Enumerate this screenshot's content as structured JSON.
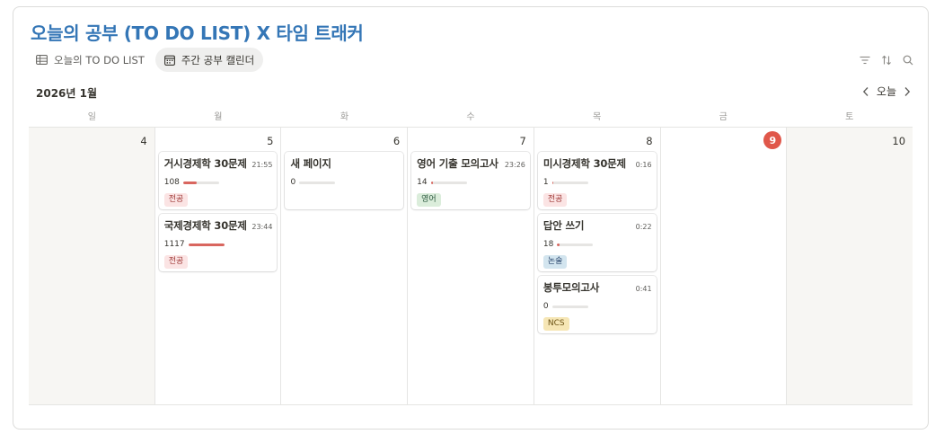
{
  "database": {
    "title": "오늘의 공부 (TO DO LIST) X 타임 트래커"
  },
  "views": [
    {
      "label": "오늘의 TO DO LIST",
      "icon": "table-icon",
      "active": false
    },
    {
      "label": "주간 공부 캘린더",
      "icon": "calendar-icon",
      "active": true
    }
  ],
  "toolbar": {
    "icons": [
      "filter-icon",
      "sort-icon",
      "search-icon"
    ]
  },
  "calendar": {
    "month": "2026년 1월",
    "today_label": "오늘",
    "weekdays": [
      "일",
      "월",
      "화",
      "수",
      "목",
      "금",
      "토"
    ],
    "days": [
      {
        "num": "4",
        "weekend": true,
        "today": false,
        "cards": []
      },
      {
        "num": "5",
        "weekend": false,
        "today": false,
        "cards": [
          {
            "title": "거시경제학 30문제",
            "time": "21:55",
            "count": "108",
            "progress": 0.38,
            "tag": "전공",
            "tag_bg": "#fbe4e4",
            "tag_fg": "#9f3a38"
          },
          {
            "title": "국제경제학 30문제",
            "time": "23:44",
            "count": "1117",
            "progress": 1.0,
            "tag": "전공",
            "tag_bg": "#fbe4e4",
            "tag_fg": "#9f3a38"
          }
        ]
      },
      {
        "num": "6",
        "weekend": false,
        "today": false,
        "cards": [
          {
            "title": "새 페이지",
            "time": "",
            "count": "0",
            "progress": 0,
            "tag": "",
            "tag_bg": "",
            "tag_fg": ""
          }
        ]
      },
      {
        "num": "7",
        "weekend": false,
        "today": false,
        "cards": [
          {
            "title": "영어 기출 모의고사",
            "time": "23:26",
            "count": "14",
            "progress": 0.05,
            "tag": "영어",
            "tag_bg": "#dbeddb",
            "tag_fg": "#2b593f"
          }
        ]
      },
      {
        "num": "8",
        "weekend": false,
        "today": false,
        "cards": [
          {
            "title": "미시경제학 30문제",
            "time": "0:16",
            "count": "1",
            "progress": 0.02,
            "tag": "전공",
            "tag_bg": "#fbe4e4",
            "tag_fg": "#9f3a38"
          },
          {
            "title": "답안 쓰기",
            "time": "0:22",
            "count": "18",
            "progress": 0.06,
            "tag": "논술",
            "tag_bg": "#d3e5ef",
            "tag_fg": "#28456c"
          },
          {
            "title": "봉투모의고사",
            "time": "0:41",
            "count": "0",
            "progress": 0,
            "tag": "NCS",
            "tag_bg": "#f6e6b5",
            "tag_fg": "#6b5214"
          }
        ]
      },
      {
        "num": "9",
        "weekend": false,
        "today": true,
        "cards": []
      },
      {
        "num": "10",
        "weekend": true,
        "today": false,
        "cards": []
      }
    ]
  }
}
